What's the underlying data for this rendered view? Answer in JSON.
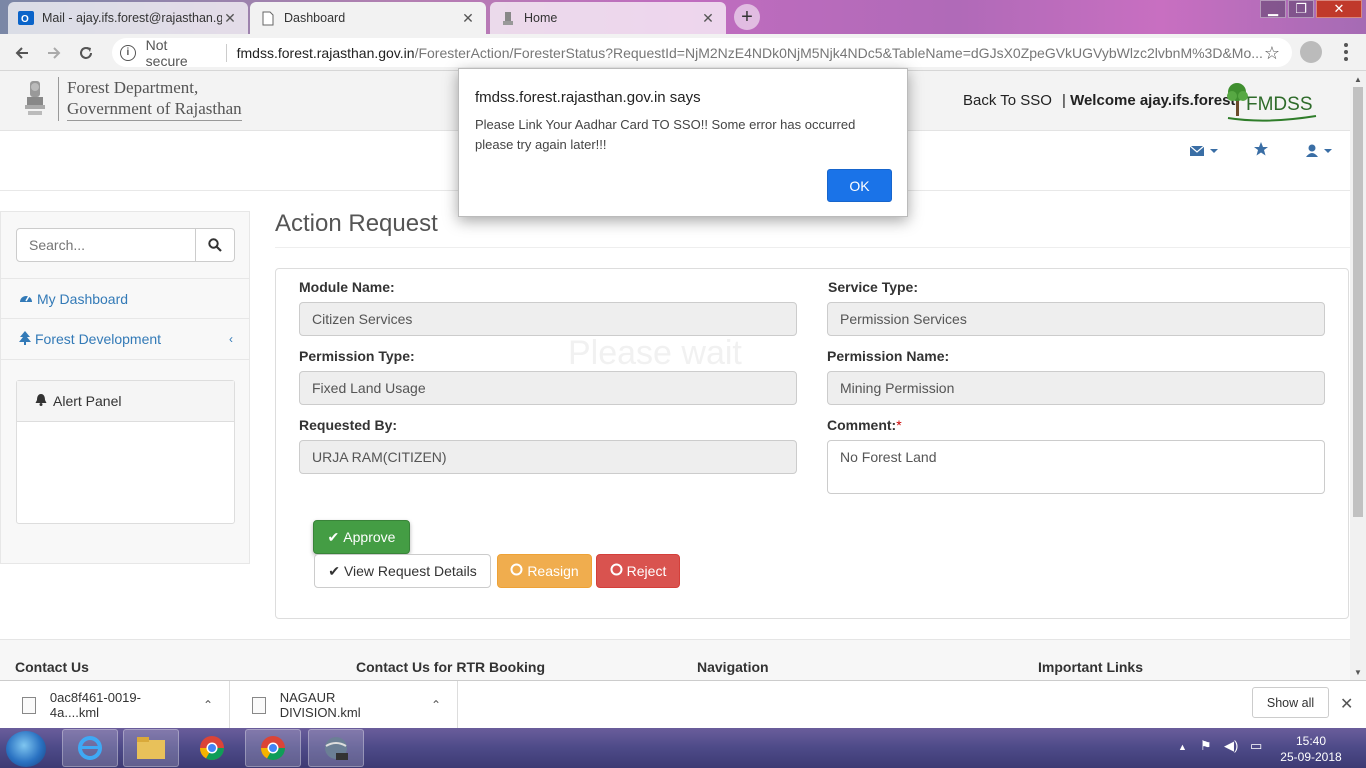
{
  "browser": {
    "tabs": [
      {
        "title": "Mail - ajay.ifs.forest@rajasthan.gov.in",
        "icon": "outlook-icon"
      },
      {
        "title": "Dashboard",
        "icon": "page-icon"
      },
      {
        "title": "Home",
        "icon": "emblem-icon"
      }
    ],
    "security_label": "Not secure",
    "url_host": "fmdss.forest.rajasthan.gov.in",
    "url_rest": "/ForesterAction/ForesterStatus?RequestId=NjM2NzE4NDk0NjM5Njk4NDc5&TableName=dGJsX0ZpeGVkUGVybWlzc2lvbnM%3D&Mo..."
  },
  "header": {
    "brand_line1": "Forest Department,",
    "brand_line2": "Government of Rajasthan",
    "back_to_sso": "Back To SSO",
    "welcome_prefix": "| ",
    "welcome_text": "Welcome ajay.ifs.forest",
    "logo_text": "FMDSS"
  },
  "sidebar": {
    "search_placeholder": "Search...",
    "items": [
      {
        "label": "My Dashboard"
      },
      {
        "label": "Forest Development"
      }
    ],
    "alert_panel_title": "Alert Panel"
  },
  "content": {
    "title": "Action Request",
    "ghost_text": "Please wait",
    "fields": {
      "module_name_label": "Module Name:",
      "module_name_value": "Citizen Services",
      "service_type_label": "Service Type:",
      "service_type_value": "Permission Services",
      "permission_type_label": "Permission Type:",
      "permission_type_value": "Fixed Land Usage",
      "permission_name_label": "Permission Name:",
      "permission_name_value": "Mining Permission",
      "requested_by_label": "Requested By:",
      "requested_by_value": "URJA RAM(CITIZEN)",
      "comment_label": "Comment:",
      "comment_required": "*",
      "comment_value": "No Forest Land"
    },
    "buttons": {
      "approve": "Approve",
      "view_details": "View Request Details",
      "reasign": "Reasign",
      "reject": "Reject"
    }
  },
  "footer": {
    "headings": [
      "Contact Us",
      "Contact Us for RTR Booking",
      "Navigation",
      "Important Links"
    ]
  },
  "dialog": {
    "title": "fmdss.forest.rajasthan.gov.in says",
    "message": "Please Link Your Aadhar Card TO SSO!! Some error has occurred please try again later!!!",
    "ok_label": "OK"
  },
  "downloads": {
    "items": [
      {
        "filename": "0ac8f461-0019-4a....kml"
      },
      {
        "filename": "NAGAUR DIVISION.kml"
      }
    ],
    "show_all": "Show all"
  },
  "taskbar": {
    "time": "15:40",
    "date": "25-09-2018"
  },
  "colors": {
    "link": "#337ab7",
    "approve": "#449d44",
    "reasign": "#f0ad4e",
    "reject": "#d9534f",
    "dialog_ok": "#1a73e8"
  }
}
